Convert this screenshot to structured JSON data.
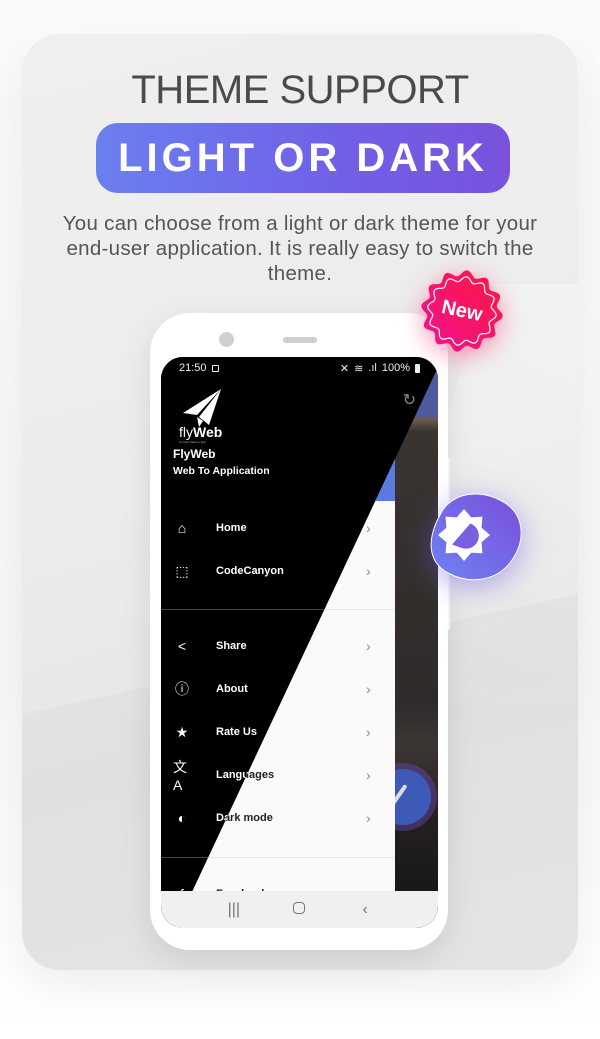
{
  "header": {
    "title": "THEME SUPPORT",
    "highlight": "LIGHT OR DARK",
    "description": "You can choose from a light or dark theme for your end-user application. It is really easy to switch the theme."
  },
  "badges": {
    "new": "New",
    "mode_icon": "brightness-auto-icon"
  },
  "colors": {
    "accent_start": "#6b7ff0",
    "accent_end": "#7a52dc",
    "drawer_header_light": "#5b7be0",
    "new_badge": "#ff1a5a",
    "title": "#4a4a4a"
  },
  "phone": {
    "status": {
      "time": "21:50",
      "battery": "100%"
    },
    "app": {
      "logo_prefix": "fly",
      "logo_suffix": "Web",
      "logo_tagline": "Convert Web to App",
      "name": "FlyWeb",
      "tagline": "Web To Application"
    },
    "menu_group_1": [
      {
        "label": "Home",
        "icon": "home-icon"
      },
      {
        "label": "CodeCanyon",
        "icon": "codecanyon-icon"
      }
    ],
    "menu_group_2": [
      {
        "label": "Share",
        "icon": "share-icon"
      },
      {
        "label": "About",
        "icon": "info-icon"
      },
      {
        "label": "Rate Us",
        "icon": "star-icon"
      },
      {
        "label": "Languages",
        "icon": "translate-icon"
      },
      {
        "label": "Dark mode",
        "icon": "brightness-icon"
      }
    ],
    "menu_group_3": [
      {
        "label": "Facebook",
        "icon": "facebook-icon"
      }
    ],
    "nav": {
      "recents": "|||",
      "back": "‹"
    }
  }
}
